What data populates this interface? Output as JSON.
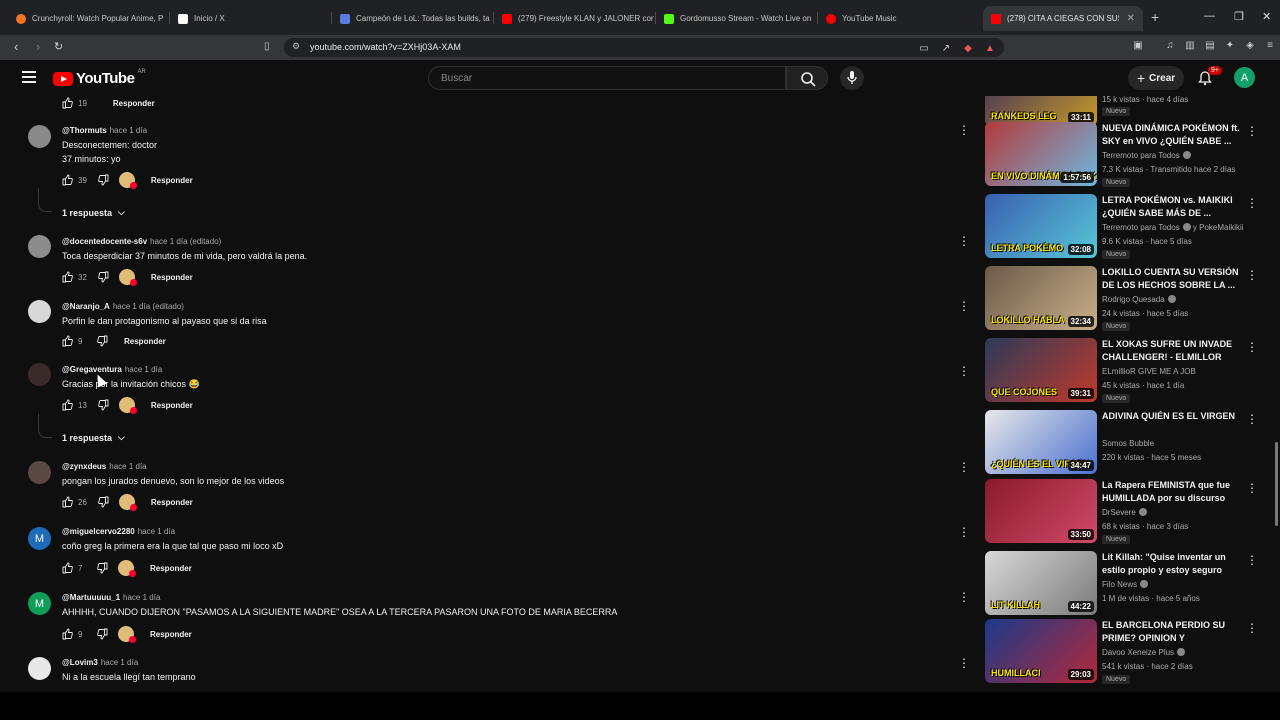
{
  "browser": {
    "tabs": [
      {
        "title": "Crunchyroll: Watch Popular Anime, P",
        "color": "#f47521"
      },
      {
        "title": "Inicio / X",
        "color": "#ffffff"
      },
      {
        "title": "Campeón de LoL: Todas las builds, ta",
        "color": "#5a7ce0"
      },
      {
        "title": "(279) Freestyle KLAN y JALONER con",
        "color": "#ff0000"
      },
      {
        "title": "Gordomusso Stream - Watch Live on",
        "color": "#53fc18"
      },
      {
        "title": "YouTube Music",
        "color": "#ff0000"
      },
      {
        "title": "(278) CITA A CIEGAS CON SUS M",
        "color": "#ff0000"
      }
    ],
    "url": "youtube.com/watch?v=ZXHj03A-XAM"
  },
  "header": {
    "logo_text": "YouTube",
    "country_code": "AR",
    "search_placeholder": "Buscar",
    "create_label": "Crear",
    "notification_count": "9+",
    "avatar_letter": "A"
  },
  "comments": [
    {
      "likes": "19",
      "reply_label": "Responder"
    },
    {
      "user": "@Thormuts",
      "time": "hace 1 día",
      "text": [
        "Desconectemen: doctor",
        "37 minutos: yo"
      ],
      "likes": "39",
      "hearted": true,
      "reply_label": "Responder",
      "replies": "1 respuesta"
    },
    {
      "user": "@docentedocente-s6v",
      "time": "hace 1 día (editado)",
      "text": [
        "Toca desperdiciar 37 minutos de mi vida, pero valdrá la pena."
      ],
      "likes": "32",
      "hearted": true,
      "reply_label": "Responder"
    },
    {
      "user": "@Naranjo_A",
      "time": "hace 1 día (editado)",
      "text": [
        "Porfin le dan protagonismo al payaso que si da risa"
      ],
      "likes": "9",
      "hearted": false,
      "reply_label": "Responder"
    },
    {
      "user": "@Gregaventura",
      "time": "hace 1 día",
      "text": [
        "Gracias por la invitación chicos 😂"
      ],
      "likes": "13",
      "hearted": true,
      "reply_label": "Responder",
      "replies": "1 respuesta"
    },
    {
      "user": "@zynxdeus",
      "time": "hace 1 día",
      "text": [
        "pongan los jurados denuevo, son lo mejor de los videos"
      ],
      "likes": "26",
      "hearted": true,
      "reply_label": "Responder"
    },
    {
      "user": "@miguelcervo2280",
      "time": "hace 1 día",
      "text": [
        "coño greg la primera era la que tal que paso mi loco xD"
      ],
      "likes": "7",
      "hearted": true,
      "reply_label": "Responder",
      "avatar_letter": "M",
      "avatar_color": "#1e6bb8"
    },
    {
      "user": "@Martuuuuu_1",
      "time": "hace 1 día",
      "text": [
        "AHHHH, CUANDO DIJERON \"PASAMOS A LA SIGUIENTE MADRE\" OSEA A LA TERCERA PASARON UNA FOTO DE MARIA BECERRA"
      ],
      "likes": "9",
      "hearted": true,
      "reply_label": "Responder",
      "avatar_letter": "M",
      "avatar_color": "#0f9d58"
    },
    {
      "user": "@Lovim3",
      "time": "hace 1 día",
      "text": [
        "Ni a la escuela llegí tan temprano"
      ]
    }
  ],
  "recommendations": [
    {
      "title": "",
      "channel": "",
      "meta": "15 k vistas · hace 4 días",
      "new": "Nuevo",
      "duration": "33:11",
      "thumb_text": "RANKEDS LEG",
      "thumb_colors": [
        "#3a2a5a",
        "#c79a2a"
      ]
    },
    {
      "title": "NUEVA DINÁMICA POKÉMON ft. SKY en VIVO ¿QUIÉN SABE ...",
      "channel": "Terremoto para Todos",
      "verified": true,
      "meta": "7.3 K vistas · Transmitido hace 2 días",
      "new": "Nuevo",
      "duration": "1:57:56",
      "thumb_text": "EN VIVO DINÁMICA POK",
      "thumb_colors": [
        "#b33a3a",
        "#6fb7e0"
      ]
    },
    {
      "title": "LETRA POKÉMON vs. MAIKIKI ¿QUIÉN SABE MÁS DE ...",
      "channel": "Terremoto para Todos",
      "verified": true,
      "channel_extra": "y PokeMaikikii",
      "meta": "9.6 K vistas · hace 5 días",
      "new": "Nuevo",
      "duration": "32:08",
      "thumb_text": "LETRA POKÉMO",
      "thumb_colors": [
        "#3a5fb0",
        "#57c7d6"
      ]
    },
    {
      "title": "LOKILLO CUENTA SU VERSIÓN DE LOS HECHOS SOBRE LA ...",
      "channel": "Rodrigo Quesada",
      "verified": true,
      "meta": "24 k vistas · hace 5 días",
      "new": "Nuevo",
      "duration": "32:34",
      "thumb_text": "LOKILLO HABLA",
      "thumb_colors": [
        "#6b5a4a",
        "#c9b08a"
      ]
    },
    {
      "title": "EL XOKAS SUFRE UN INVADE CHALLENGER! - ELMILLOR",
      "channel": "ELmillioR GIVE ME A JOB",
      "verified": false,
      "meta": "45 k vistas · hace 1 día",
      "new": "Nuevo",
      "duration": "39:31",
      "thumb_text": "QUE COJONES",
      "thumb_colors": [
        "#2a3a5a",
        "#c0392b"
      ]
    },
    {
      "title": "ADIVINA QUIÉN ES EL VIRGEN",
      "channel": "Somos Bubble",
      "verified": false,
      "meta": "220 k vistas · hace 5 meses",
      "new": "",
      "duration": "34:47",
      "thumb_text": "¿QUIÉN ES EL VIRGEN",
      "thumb_colors": [
        "#e8e8e8",
        "#4a6fd0"
      ]
    },
    {
      "title": "La Rapera FEMINISTA que fue HUMILLADA por su discurso",
      "channel": "DrSevere",
      "verified": true,
      "meta": "68 k vistas · hace 3 días",
      "new": "Nuevo",
      "duration": "33:50",
      "thumb_text": "",
      "thumb_colors": [
        "#8a1a2a",
        "#d04a6a"
      ]
    },
    {
      "title": "Lit Killah: \"Quise inventar un estilo propio y estoy seguro de...",
      "channel": "Filo News",
      "verified": true,
      "meta": "1 M de vistas · hace 5 años",
      "new": "",
      "duration": "44:22",
      "thumb_text": "LIT KILLAH",
      "thumb_colors": [
        "#d8d8d8",
        "#7a7a7a"
      ]
    },
    {
      "title": "EL BARCELONA PERDIO SU PRIME? OPINION Y REACCION...",
      "channel": "Davoo Xeneize Plus",
      "verified": true,
      "meta": "541 k vistas · hace 2 días",
      "new": "Nuevo",
      "duration": "29:03",
      "thumb_text": "HUMILLACI",
      "thumb_colors": [
        "#1a3a8a",
        "#b3283a"
      ]
    }
  ]
}
